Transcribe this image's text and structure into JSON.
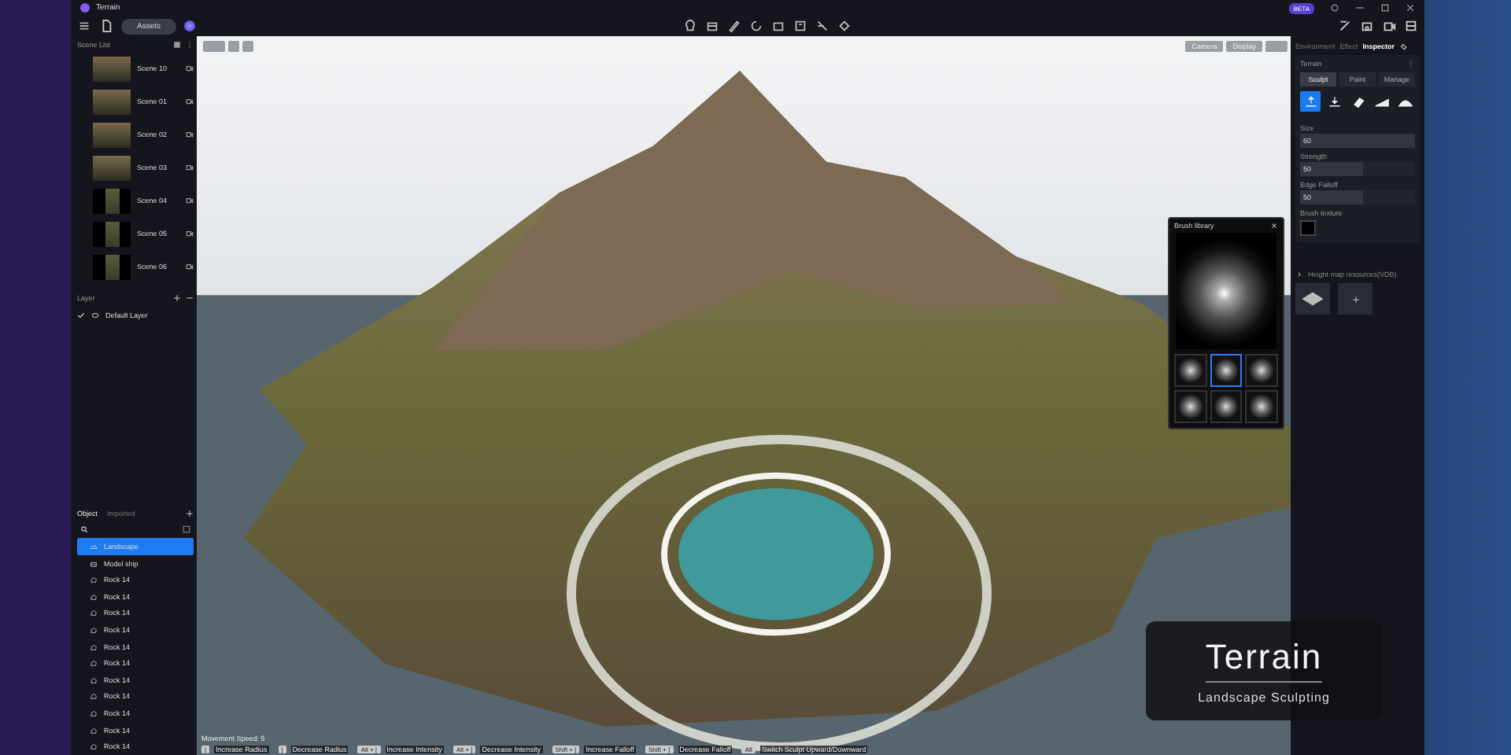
{
  "window": {
    "title": "Terrain",
    "badge": "BETA"
  },
  "toolbar": {
    "assets_label": "Assets"
  },
  "scene_list": {
    "title": "Scene List",
    "scenes": [
      {
        "name": "Scene 10",
        "portrait": false
      },
      {
        "name": "Scene 01",
        "portrait": false
      },
      {
        "name": "Scene 02",
        "portrait": false
      },
      {
        "name": "Scene 03",
        "portrait": false
      },
      {
        "name": "Scene 04",
        "portrait": true
      },
      {
        "name": "Scene 05",
        "portrait": true
      },
      {
        "name": "Scene 06",
        "portrait": true
      }
    ]
  },
  "layers": {
    "title": "Layer",
    "items": [
      {
        "name": "Default Layer",
        "visible": true
      }
    ]
  },
  "objects": {
    "tabs": [
      {
        "label": "Object",
        "selected": true
      },
      {
        "label": "Imported",
        "selected": false
      }
    ],
    "items": [
      {
        "name": "Landscape",
        "kind": "terrain",
        "selected": true
      },
      {
        "name": "Model ship",
        "kind": "model",
        "selected": false
      },
      {
        "name": "Rock 14",
        "kind": "rock",
        "selected": false
      },
      {
        "name": "Rock 14",
        "kind": "rock",
        "selected": false
      },
      {
        "name": "Rock 14",
        "kind": "rock",
        "selected": false
      },
      {
        "name": "Rock 14",
        "kind": "rock",
        "selected": false
      },
      {
        "name": "Rock 14",
        "kind": "rock",
        "selected": false
      },
      {
        "name": "Rock 14",
        "kind": "rock",
        "selected": false
      },
      {
        "name": "Rock 14",
        "kind": "rock",
        "selected": false
      },
      {
        "name": "Rock 14",
        "kind": "rock",
        "selected": false
      },
      {
        "name": "Rock 14",
        "kind": "rock",
        "selected": false
      },
      {
        "name": "Rock 14",
        "kind": "rock",
        "selected": false
      },
      {
        "name": "Rock 14",
        "kind": "rock",
        "selected": false
      }
    ]
  },
  "viewport": {
    "buttons": [
      "Camera",
      "Display"
    ],
    "movement_speed": "Movement Speed: 5",
    "shortcuts": [
      {
        "key": "[",
        "action": "Increase Radius"
      },
      {
        "key": "]",
        "action": "Decrease Radius"
      },
      {
        "key": "Alt + [",
        "action": "Increase Intensity"
      },
      {
        "key": "Alt + ]",
        "action": "Decrease Intensity"
      },
      {
        "key": "Shift + [",
        "action": "Increase Falloff"
      },
      {
        "key": "Shift + ]",
        "action": "Decrease Falloff"
      },
      {
        "key": "Alt",
        "action": "Switch Sculpt Upward/Downward"
      }
    ]
  },
  "brush_library": {
    "title": "Brush library",
    "brushes": [
      {
        "selected": false
      },
      {
        "selected": true
      },
      {
        "selected": false
      },
      {
        "selected": false
      },
      {
        "selected": false
      },
      {
        "selected": false
      }
    ]
  },
  "caption": {
    "title": "Terrain",
    "subtitle": "Landscape Sculpting"
  },
  "inspector": {
    "tabs": [
      {
        "label": "Environment",
        "selected": false
      },
      {
        "label": "Effect",
        "selected": false
      },
      {
        "label": "Inspector",
        "selected": true
      }
    ],
    "section": "Terrain",
    "modes": [
      {
        "label": "Sculpt",
        "selected": true
      },
      {
        "label": "Paint",
        "selected": false
      },
      {
        "label": "Manage",
        "selected": false
      }
    ],
    "tools": [
      {
        "kind": "raise",
        "selected": true
      },
      {
        "kind": "lower",
        "selected": false
      },
      {
        "kind": "eraser",
        "selected": false
      },
      {
        "kind": "ramp",
        "selected": false
      },
      {
        "kind": "mound",
        "selected": false
      }
    ],
    "fields": [
      {
        "label": "Size",
        "value": "60"
      },
      {
        "label": "Strength",
        "value": "50"
      },
      {
        "label": "Edge Falloff",
        "value": "50"
      }
    ],
    "brush_texture_label": "Brush texture",
    "heightmap_label": "Height map resources(VDB)"
  }
}
